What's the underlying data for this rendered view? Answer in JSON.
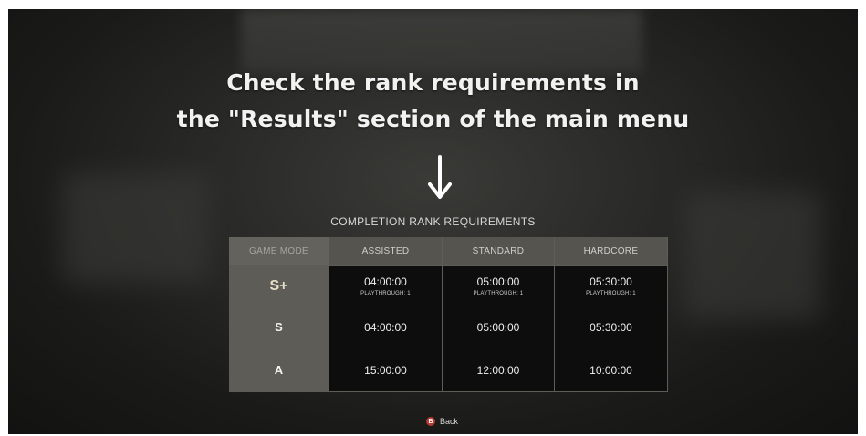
{
  "headline": {
    "line1": "Check the rank requirements in",
    "line2": "the \"Results\" section of the main menu"
  },
  "table": {
    "title": "COMPLETION RANK REQUIREMENTS",
    "columns": [
      "GAME MODE",
      "ASSISTED",
      "STANDARD",
      "HARDCORE"
    ],
    "rows": [
      {
        "rank": "S+",
        "cells": [
          {
            "time": "04:00:00",
            "sub": "PLAYTHROUGH: 1"
          },
          {
            "time": "05:00:00",
            "sub": "PLAYTHROUGH: 1"
          },
          {
            "time": "05:30:00",
            "sub": "PLAYTHROUGH: 1"
          }
        ]
      },
      {
        "rank": "S",
        "cells": [
          {
            "time": "04:00:00"
          },
          {
            "time": "05:00:00"
          },
          {
            "time": "05:30:00"
          }
        ]
      },
      {
        "rank": "A",
        "cells": [
          {
            "time": "15:00:00"
          },
          {
            "time": "12:00:00"
          },
          {
            "time": "10:00:00"
          }
        ]
      }
    ]
  },
  "footer": {
    "back_button_glyph": "B",
    "back_label": "Back"
  },
  "icons": {
    "arrow": "arrow-down-icon",
    "back": "b-button-icon"
  },
  "colors": {
    "rank_column_bg": "#5d5c56",
    "value_cell_bg": "#0d0d0d",
    "back_button": "#b33b32"
  }
}
